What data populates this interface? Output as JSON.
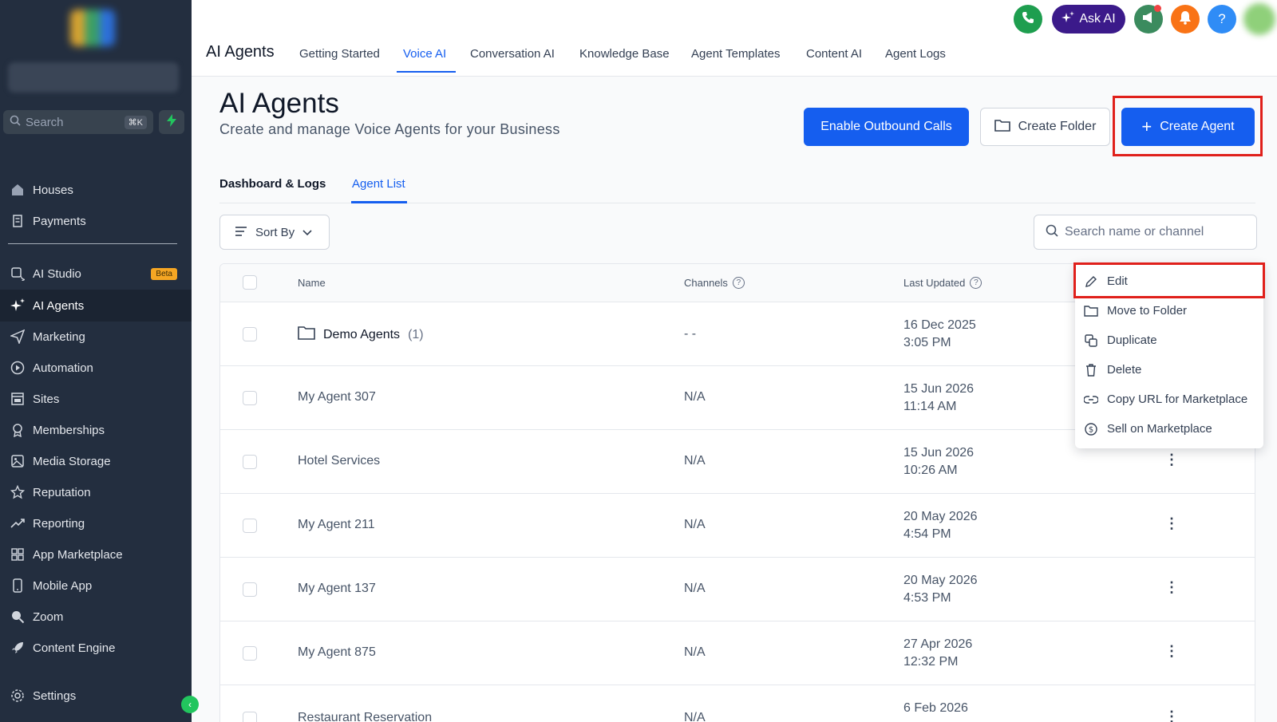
{
  "sidebar": {
    "search_placeholder": "Search",
    "search_shortcut": "⌘K",
    "items": [
      {
        "label": "Houses",
        "icon": "home-icon"
      },
      {
        "label": "Payments",
        "icon": "receipt-icon"
      },
      {
        "label": "AI Studio",
        "icon": "ai-studio-icon",
        "badge": "Beta"
      },
      {
        "label": "AI Agents",
        "icon": "sparkle-icon",
        "active": true
      },
      {
        "label": "Marketing",
        "icon": "send-icon"
      },
      {
        "label": "Automation",
        "icon": "automation-icon"
      },
      {
        "label": "Sites",
        "icon": "sites-icon"
      },
      {
        "label": "Memberships",
        "icon": "membership-icon"
      },
      {
        "label": "Media Storage",
        "icon": "image-icon"
      },
      {
        "label": "Reputation",
        "icon": "star-icon"
      },
      {
        "label": "Reporting",
        "icon": "trend-icon"
      },
      {
        "label": "App Marketplace",
        "icon": "grid-icon"
      },
      {
        "label": "Mobile App",
        "icon": "mobile-icon"
      },
      {
        "label": "Zoom",
        "icon": "zoom-icon"
      },
      {
        "label": "Content Engine",
        "icon": "rocket-icon"
      },
      {
        "label": "Settings",
        "icon": "gear-icon"
      }
    ]
  },
  "topbar": {
    "app_title": "AI Agents",
    "tabs": [
      "Getting Started",
      "Voice AI",
      "Conversation AI",
      "Knowledge Base",
      "Agent Templates",
      "Content AI",
      "Agent Logs"
    ],
    "active_tab": "Voice AI",
    "ask_ai_label": "Ask AI"
  },
  "header": {
    "title": "AI Agents",
    "subtitle": "Create and manage Voice Agents for your Business",
    "enable_outbound_label": "Enable Outbound Calls",
    "create_folder_label": "Create Folder",
    "create_agent_label": "Create Agent"
  },
  "subtabs": {
    "dashboard": "Dashboard & Logs",
    "agent_list": "Agent List"
  },
  "toolbar": {
    "sort_label": "Sort By",
    "search_placeholder": "Search name or channel"
  },
  "table": {
    "columns": {
      "name": "Name",
      "channels": "Channels",
      "updated": "Last Updated"
    },
    "rows": [
      {
        "name": "Demo Agents",
        "count": "(1)",
        "folder": true,
        "channel": "- -",
        "date": "16 Dec 2025",
        "time": "3:05 PM"
      },
      {
        "name": "My Agent 307",
        "channel": "N/A",
        "date": "15 Jun 2026",
        "time": "11:14 AM"
      },
      {
        "name": "Hotel Services",
        "channel": "N/A",
        "date": "15 Jun 2026",
        "time": "10:26 AM"
      },
      {
        "name": "My Agent 211",
        "channel": "N/A",
        "date": "20 May 2026",
        "time": "4:54 PM"
      },
      {
        "name": "My Agent 137",
        "channel": "N/A",
        "date": "20 May 2026",
        "time": "4:53 PM"
      },
      {
        "name": "My Agent 875",
        "channel": "N/A",
        "date": "27 Apr 2026",
        "time": "12:32 PM"
      },
      {
        "name": "Restaurant Reservation",
        "channel": "N/A",
        "date": "6 Feb 2026",
        "time": ""
      }
    ]
  },
  "menu": {
    "items": [
      "Edit",
      "Move to Folder",
      "Duplicate",
      "Delete",
      "Copy URL for Marketplace",
      "Sell on Marketplace"
    ]
  },
  "colors": {
    "primary": "#155eef",
    "sidebar": "#232e3f",
    "highlight": "#e0201b"
  }
}
